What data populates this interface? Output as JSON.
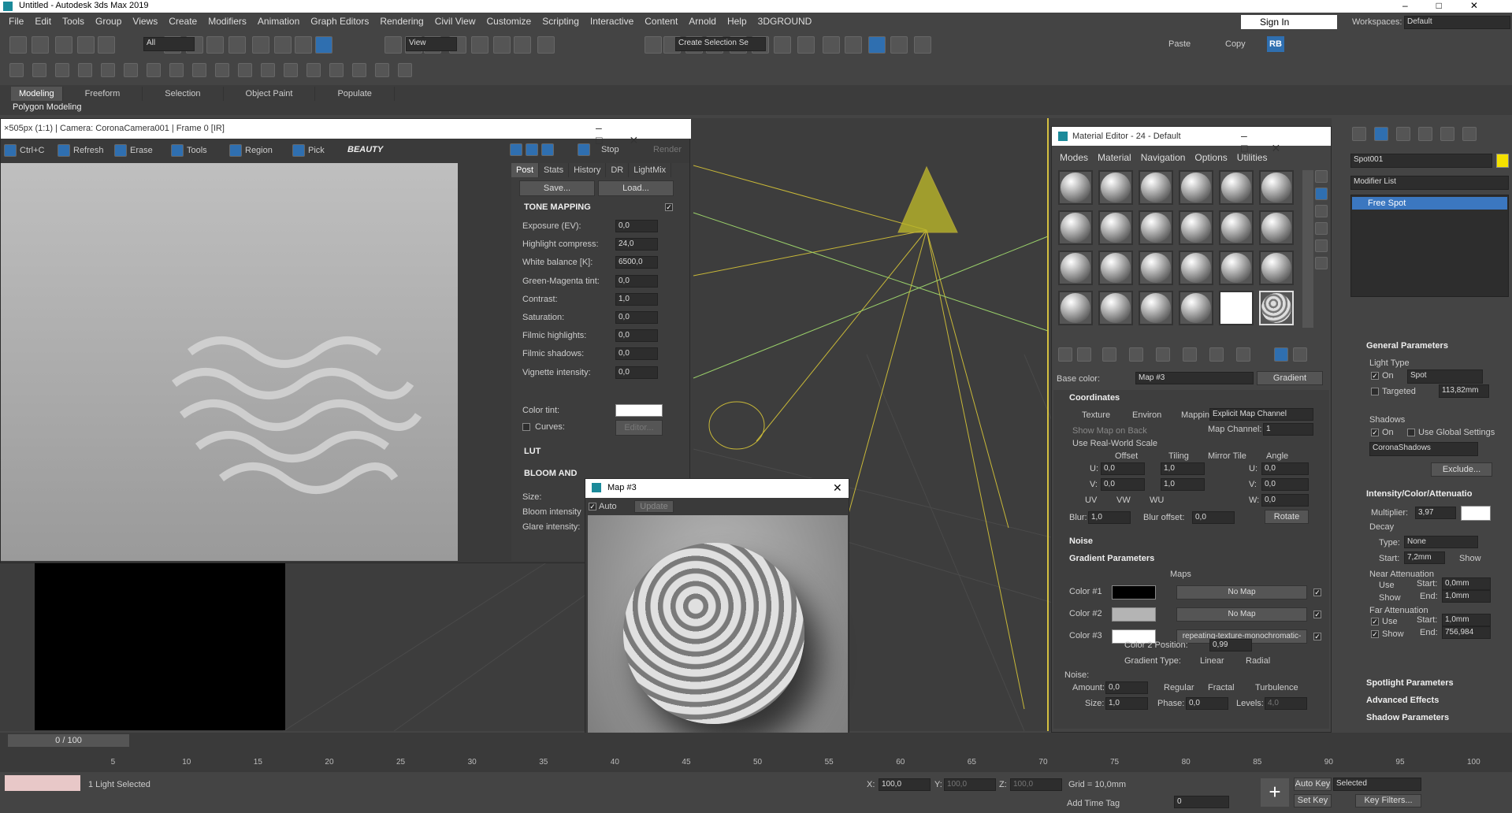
{
  "window": {
    "title": "Untitled - Autodesk 3ds Max 2019"
  },
  "menu": [
    "File",
    "Edit",
    "Tools",
    "Group",
    "Views",
    "Create",
    "Modifiers",
    "Animation",
    "Graph Editors",
    "Rendering",
    "Civil View",
    "Customize",
    "Scripting",
    "Interactive",
    "Content",
    "Arnold",
    "Help",
    "3DGROUND"
  ],
  "signin": "Sign In",
  "workspaces": {
    "label": "Workspaces:",
    "value": "Default"
  },
  "toolbar": {
    "filter": "All",
    "view": "View",
    "selection_set": "Create Selection Se",
    "paste": "Paste",
    "copy": "Copy",
    "rb": "RB"
  },
  "ribbon": {
    "tabs": [
      "Modeling",
      "Freeform",
      "Selection",
      "Object Paint",
      "Populate"
    ],
    "sub": "Polygon Modeling"
  },
  "vfb": {
    "title": "×505px (1:1) | Camera: CoronaCamera001 | Frame 0 [IR]",
    "toolbar": [
      "Ctrl+C",
      "Refresh",
      "Erase",
      "Tools",
      "Region",
      "Pick"
    ],
    "pass": "BEAUTY",
    "stop": "Stop",
    "render": "Render",
    "tabs": [
      "Post",
      "Stats",
      "History",
      "DR",
      "LightMix"
    ],
    "save": "Save...",
    "load": "Load...",
    "tone_mapping": "TONE MAPPING",
    "params": [
      {
        "label": "Exposure (EV):",
        "value": "0,0"
      },
      {
        "label": "Highlight compress:",
        "value": "24,0"
      },
      {
        "label": "White balance [K]:",
        "value": "6500,0"
      },
      {
        "label": "Green-Magenta tint:",
        "value": "0,0"
      },
      {
        "label": "Contrast:",
        "value": "1,0"
      },
      {
        "label": "Saturation:",
        "value": "0,0"
      },
      {
        "label": "Filmic highlights:",
        "value": "0,0"
      },
      {
        "label": "Filmic shadows:",
        "value": "0,0"
      },
      {
        "label": "Vignette intensity:",
        "value": "0,0"
      }
    ],
    "color_tint": "Color tint:",
    "curves": "Curves:",
    "editor": "Editor...",
    "lut": "LUT",
    "bloom": "BLOOM AND",
    "size": "Size:",
    "bloom_int": "Bloom intensity",
    "glare_int": "Glare intensity:"
  },
  "map_window": {
    "title": "Map #3",
    "auto": "Auto",
    "update": "Update"
  },
  "mat": {
    "title": "Material Editor - 24 - Default",
    "menu": [
      "Modes",
      "Material",
      "Navigation",
      "Options",
      "Utilities"
    ],
    "base_color": "Base color:",
    "map_name": "Map #3",
    "map_type": "Gradient",
    "coordinates": "Coordinates",
    "texture": "Texture",
    "environ": "Environ",
    "mapping_lbl": "Mapping:",
    "mapping": "Explicit Map Channel",
    "show_map": "Show Map on Back",
    "map_channel_lbl": "Map Channel:",
    "map_channel": "1",
    "real_world": "Use Real-World Scale",
    "offset": "Offset",
    "tiling": "Tiling",
    "mirror_tile": "Mirror Tile",
    "angle": "Angle",
    "u": "U:",
    "v": "V:",
    "w": "W:",
    "u_off": "0,0",
    "v_off": "0,0",
    "u_tile": "1,0",
    "v_tile": "1,0",
    "u_ang": "0,0",
    "v_ang": "0,0",
    "w_ang": "0,0",
    "uv": "UV",
    "vw": "VW",
    "wu": "WU",
    "blur_lbl": "Blur:",
    "blur": "1,0",
    "blur_off_lbl": "Blur offset:",
    "blur_off": "0,0",
    "rotate": "Rotate",
    "noise": "Noise",
    "gradient_params": "Gradient Parameters",
    "maps": "Maps",
    "colors": [
      {
        "label": "Color #1",
        "swatch": "#000000",
        "map": "No Map"
      },
      {
        "label": "Color #2",
        "swatch": "#b4b4b4",
        "map": "No Map"
      },
      {
        "label": "Color #3",
        "swatch": "#ffffff",
        "map": "repeating-texture-monochromatic-"
      }
    ],
    "c2pos_lbl": "Color 2 Position:",
    "c2pos": "0,99",
    "grad_type": "Gradient Type:",
    "linear": "Linear",
    "radial": "Radial",
    "noise2": "Noise:",
    "amount_lbl": "Amount:",
    "amount": "0,0",
    "regular": "Regular",
    "fractal": "Fractal",
    "turbulence": "Turbulence",
    "size_lbl": "Size:",
    "size": "1,0",
    "phase_lbl": "Phase:",
    "phase": "0,0",
    "levels_lbl": "Levels:",
    "levels": "4,0"
  },
  "cmd": {
    "object": "Spot001",
    "modifier_list": "Modifier List",
    "stack_item": "Free Spot",
    "general": "General Parameters",
    "light_type": "Light Type",
    "on": "On",
    "spot": "Spot",
    "targeted": "Targeted",
    "target_dist": "113,82mm",
    "shadows": "Shadows",
    "use_global": "Use Global Settings",
    "shadow_type": "CoronaShadows",
    "exclude": "Exclude...",
    "intensity": "Intensity/Color/Attenuatio",
    "multiplier_lbl": "Multiplier:",
    "multiplier": "3,97",
    "decay": "Decay",
    "type_lbl": "Type:",
    "type": "None",
    "start_lbl": "Start:",
    "start": "7,2mm",
    "show": "Show",
    "near": "Near Attenuation",
    "use": "Use",
    "n_start": "0,0mm",
    "end_lbl": "End:",
    "n_end": "1,0mm",
    "far": "Far Attenuation",
    "f_start": "1,0mm",
    "f_end": "756,984",
    "rollouts": [
      "Spotlight Parameters",
      "Advanced Effects",
      "Shadow Parameters"
    ]
  },
  "timeline": {
    "frame": "0 / 100",
    "ticks": [
      "5",
      "10",
      "15",
      "20",
      "25",
      "30",
      "35",
      "40",
      "45",
      "50",
      "55",
      "60",
      "65",
      "70",
      "75",
      "80",
      "85",
      "90",
      "95",
      "100"
    ]
  },
  "status": {
    "selected": "1 Light Selected",
    "x_lbl": "X:",
    "x": "100,0",
    "y_lbl": "Y:",
    "y": "100,0",
    "z_lbl": "Z:",
    "z": "100,0",
    "grid": "Grid = 10,0mm",
    "add_time_tag": "Add Time Tag",
    "auto_key": "Auto Key",
    "set_key": "Set Key",
    "selected_opt": "Selected",
    "key_filters": "Key Filters...",
    "frame_field": "0"
  }
}
